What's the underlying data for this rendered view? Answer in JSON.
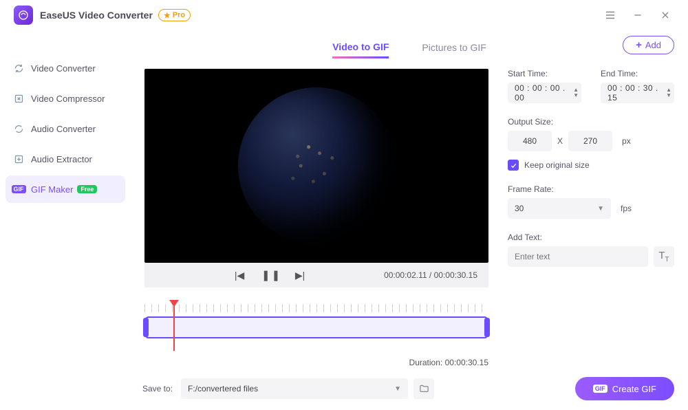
{
  "app": {
    "title": "EaseUS Video Converter",
    "pro_badge": "Pro"
  },
  "sidebar": {
    "items": [
      {
        "label": "Video Converter"
      },
      {
        "label": "Video Compressor"
      },
      {
        "label": "Audio Converter"
      },
      {
        "label": "Audio Extractor"
      },
      {
        "label": "GIF Maker",
        "badge": "Free"
      }
    ]
  },
  "tabs": {
    "video_to_gif": "Video to GIF",
    "pictures_to_gif": "Pictures to GIF"
  },
  "add_button": "Add",
  "player": {
    "current_time": "00:00:02.11",
    "total_time": "00:00:30.15"
  },
  "duration_label": "Duration:",
  "duration_value": "00:00:30.15",
  "settings": {
    "start_time_label": "Start Time:",
    "start_time": "00 : 00 : 00 . 00",
    "end_time_label": "End Time:",
    "end_time": "00 : 00 : 30 . 15",
    "output_size_label": "Output Size:",
    "width": "480",
    "height": "270",
    "x": "X",
    "px": "px",
    "keep_original": "Keep original size",
    "keep_original_checked": true,
    "frame_rate_label": "Frame Rate:",
    "frame_rate": "30",
    "fps": "fps",
    "add_text_label": "Add Text:",
    "add_text_placeholder": "Enter text"
  },
  "footer": {
    "save_to_label": "Save to:",
    "save_to_path": "F:/convertered files",
    "create_label": "Create GIF"
  }
}
